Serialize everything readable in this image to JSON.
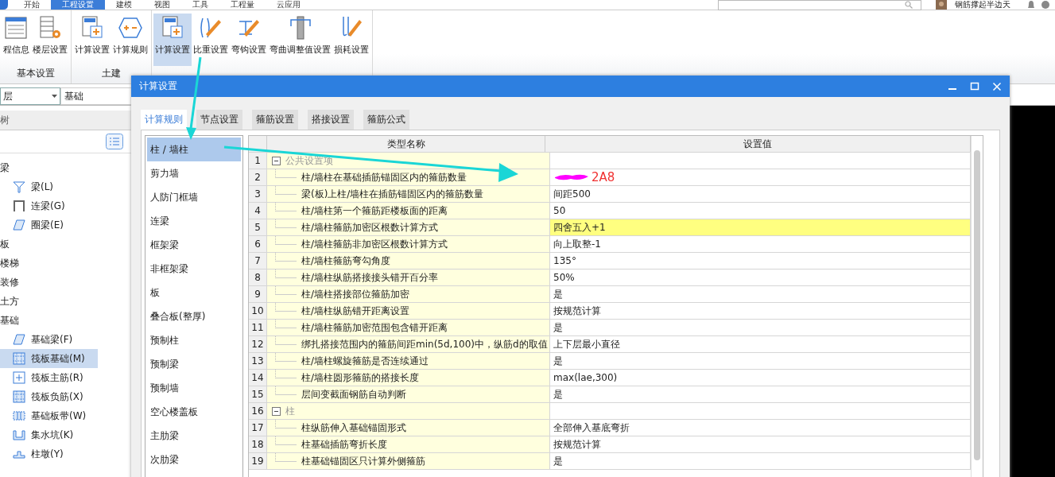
{
  "menu_tabs": [
    {
      "label": "开始",
      "selected": false
    },
    {
      "label": "工程设置",
      "selected": true
    },
    {
      "label": "建模",
      "selected": false
    },
    {
      "label": "视图",
      "selected": false
    },
    {
      "label": "工具",
      "selected": false
    },
    {
      "label": "工程量",
      "selected": false
    },
    {
      "label": "云应用",
      "selected": false
    }
  ],
  "user": {
    "name": "钢筋撑起半边天"
  },
  "ribbon": [
    {
      "label": "基本设置",
      "buttons": [
        {
          "label": "程信息",
          "kind": "sheet",
          "selected": false
        },
        {
          "label": "楼层设置",
          "kind": "floors",
          "selected": false
        }
      ]
    },
    {
      "label": "土建",
      "buttons": [
        {
          "label": "计算设置",
          "kind": "calc",
          "selected": false
        },
        {
          "label": "计算规则",
          "kind": "rule",
          "selected": false
        }
      ]
    },
    {
      "buttons": [
        {
          "label": "计算设置",
          "kind": "calc",
          "selected": true
        },
        {
          "label": "比重设置",
          "kind": "bar",
          "selected": false
        },
        {
          "label": "弯钩设置",
          "kind": "hook",
          "selected": false
        },
        {
          "label": "弯曲调整值设置",
          "kind": "column",
          "selected": false
        },
        {
          "label": "损耗设置",
          "kind": "loss",
          "selected": false
        }
      ]
    }
  ],
  "floor_select": {
    "value": "层"
  },
  "part_select": {
    "value": "基础"
  },
  "tree_panel": {
    "title": "树",
    "items": [
      {
        "label": "梁",
        "children": [
          {
            "label": "梁(L)",
            "kind": "beam",
            "selected": false
          },
          {
            "label": "连梁(G)",
            "kind": "link",
            "selected": false
          },
          {
            "label": "圈梁(E)",
            "kind": "ring",
            "selected": false
          }
        ]
      },
      {
        "label": "板"
      },
      {
        "label": "楼梯"
      },
      {
        "label": "装修"
      },
      {
        "label": "土方"
      },
      {
        "label": "基础",
        "children": [
          {
            "label": "基础梁(F)",
            "kind": "ring",
            "selected": false
          },
          {
            "label": "筏板基础(M)",
            "kind": "raft",
            "selected": true
          },
          {
            "label": "筏板主筋(R)",
            "kind": "plus",
            "selected": false
          },
          {
            "label": "筏板负筋(X)",
            "kind": "raft",
            "selected": false
          },
          {
            "label": "基础板带(W)",
            "kind": "strip",
            "selected": false
          },
          {
            "label": "集水坑(K)",
            "kind": "pit",
            "selected": false
          },
          {
            "label": "柱墩(Y)",
            "kind": "pier",
            "selected": false
          }
        ]
      }
    ]
  },
  "dialog": {
    "title": "计算设置",
    "tabs": [
      {
        "label": "计算规则",
        "selected": true
      },
      {
        "label": "节点设置",
        "selected": false
      },
      {
        "label": "箍筋设置",
        "selected": false
      },
      {
        "label": "搭接设置",
        "selected": false
      },
      {
        "label": "箍筋公式",
        "selected": false
      }
    ],
    "categories": [
      {
        "label": "柱 / 墙柱",
        "selected": true
      },
      {
        "label": "剪力墙",
        "selected": false
      },
      {
        "label": "人防门框墙",
        "selected": false
      },
      {
        "label": "连梁",
        "selected": false
      },
      {
        "label": "框架梁",
        "selected": false
      },
      {
        "label": "非框架梁",
        "selected": false
      },
      {
        "label": "板",
        "selected": false
      },
      {
        "label": "叠合板(整厚)",
        "selected": false
      },
      {
        "label": "预制柱",
        "selected": false
      },
      {
        "label": "预制梁",
        "selected": false
      },
      {
        "label": "预制墙",
        "selected": false
      },
      {
        "label": "空心楼盖板",
        "selected": false
      },
      {
        "label": "主肋梁",
        "selected": false
      },
      {
        "label": "次肋梁",
        "selected": false
      }
    ],
    "columns": [
      "类型名称",
      "设置值"
    ],
    "rows": [
      {
        "no": "1",
        "kind": "group",
        "name": "公共设置项",
        "expanded": true
      },
      {
        "no": "2",
        "kind": "setting",
        "name": "柱/墙柱在基础插筋锚固区内的箍筋数量",
        "value": "2A8",
        "redacted": true,
        "selected": false
      },
      {
        "no": "3",
        "kind": "setting",
        "name": "梁(板)上柱/墙柱在插筋锚固区内的箍筋数量",
        "value": "间距500",
        "selected": false
      },
      {
        "no": "4",
        "kind": "setting",
        "name": "柱/墙柱第一个箍筋距楼板面的距离",
        "value": "50",
        "selected": false
      },
      {
        "no": "5",
        "kind": "setting",
        "name": "柱/墙柱箍筋加密区根数计算方式",
        "value": "四舍五入+1",
        "selected": true
      },
      {
        "no": "6",
        "kind": "setting",
        "name": "柱/墙柱箍筋非加密区根数计算方式",
        "value": "向上取整-1",
        "selected": false
      },
      {
        "no": "7",
        "kind": "setting",
        "name": "柱/墙柱箍筋弯勾角度",
        "value": "135°",
        "selected": false
      },
      {
        "no": "8",
        "kind": "setting",
        "name": "柱/墙柱纵筋搭接接头错开百分率",
        "value": "50%",
        "selected": false
      },
      {
        "no": "9",
        "kind": "setting",
        "name": "柱/墙柱搭接部位箍筋加密",
        "value": "是",
        "selected": false
      },
      {
        "no": "10",
        "kind": "setting",
        "name": "柱/墙柱纵筋错开距离设置",
        "value": "按规范计算",
        "selected": false
      },
      {
        "no": "11",
        "kind": "setting",
        "name": "柱/墙柱箍筋加密范围包含错开距离",
        "value": "是",
        "selected": false
      },
      {
        "no": "12",
        "kind": "setting",
        "name": "绑扎搭接范围内的箍筋间距min(5d,100)中，纵筋d的取值",
        "value": "上下层最小直径",
        "selected": false
      },
      {
        "no": "13",
        "kind": "setting",
        "name": "柱/墙柱螺旋箍筋是否连续通过",
        "value": "是",
        "selected": false
      },
      {
        "no": "14",
        "kind": "setting",
        "name": "柱/墙柱圆形箍筋的搭接长度",
        "value": "max(lae,300)",
        "selected": false
      },
      {
        "no": "15",
        "kind": "setting",
        "name": "层间变截面钢筋自动判断",
        "value": "是",
        "selected": false
      },
      {
        "no": "16",
        "kind": "group",
        "name": "柱",
        "expanded": true
      },
      {
        "no": "17",
        "kind": "setting",
        "name": "柱纵筋伸入基础锚固形式",
        "value": "全部伸入基底弯折",
        "selected": false
      },
      {
        "no": "18",
        "kind": "setting",
        "name": "柱基础插筋弯折长度",
        "value": "按规范计算",
        "selected": false
      },
      {
        "no": "19",
        "kind": "setting",
        "name": "柱基础锚固区只计算外侧箍筋",
        "value": "是",
        "selected": false
      }
    ]
  }
}
